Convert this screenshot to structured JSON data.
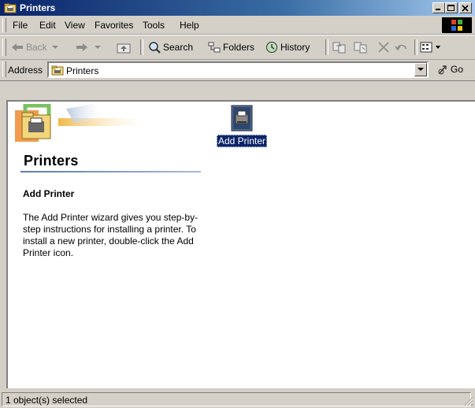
{
  "window": {
    "title": "Printers"
  },
  "menu": {
    "items": [
      {
        "label": "File"
      },
      {
        "label": "Edit"
      },
      {
        "label": "View"
      },
      {
        "label": "Favorites"
      },
      {
        "label": "Tools"
      },
      {
        "label": "Help"
      }
    ]
  },
  "toolbar": {
    "back_label": "Back",
    "search_label": "Search",
    "folders_label": "Folders",
    "history_label": "History"
  },
  "address": {
    "label": "Address",
    "value": "Printers",
    "go_label": "Go"
  },
  "content": {
    "folder_title": "Printers",
    "selected_title": "Add Printer",
    "selected_description": "The Add Printer wizard gives you step-by-step instructions for installing a printer. To install a new printer, double-click the Add Printer icon.",
    "items": [
      {
        "label": "Add Printer"
      }
    ]
  },
  "status": {
    "text": "1 object(s) selected"
  },
  "colors": {
    "titlebar_start": "#0a246a",
    "titlebar_end": "#a6caf0",
    "selection": "#0a246a",
    "chrome": "#d4d0c8"
  }
}
